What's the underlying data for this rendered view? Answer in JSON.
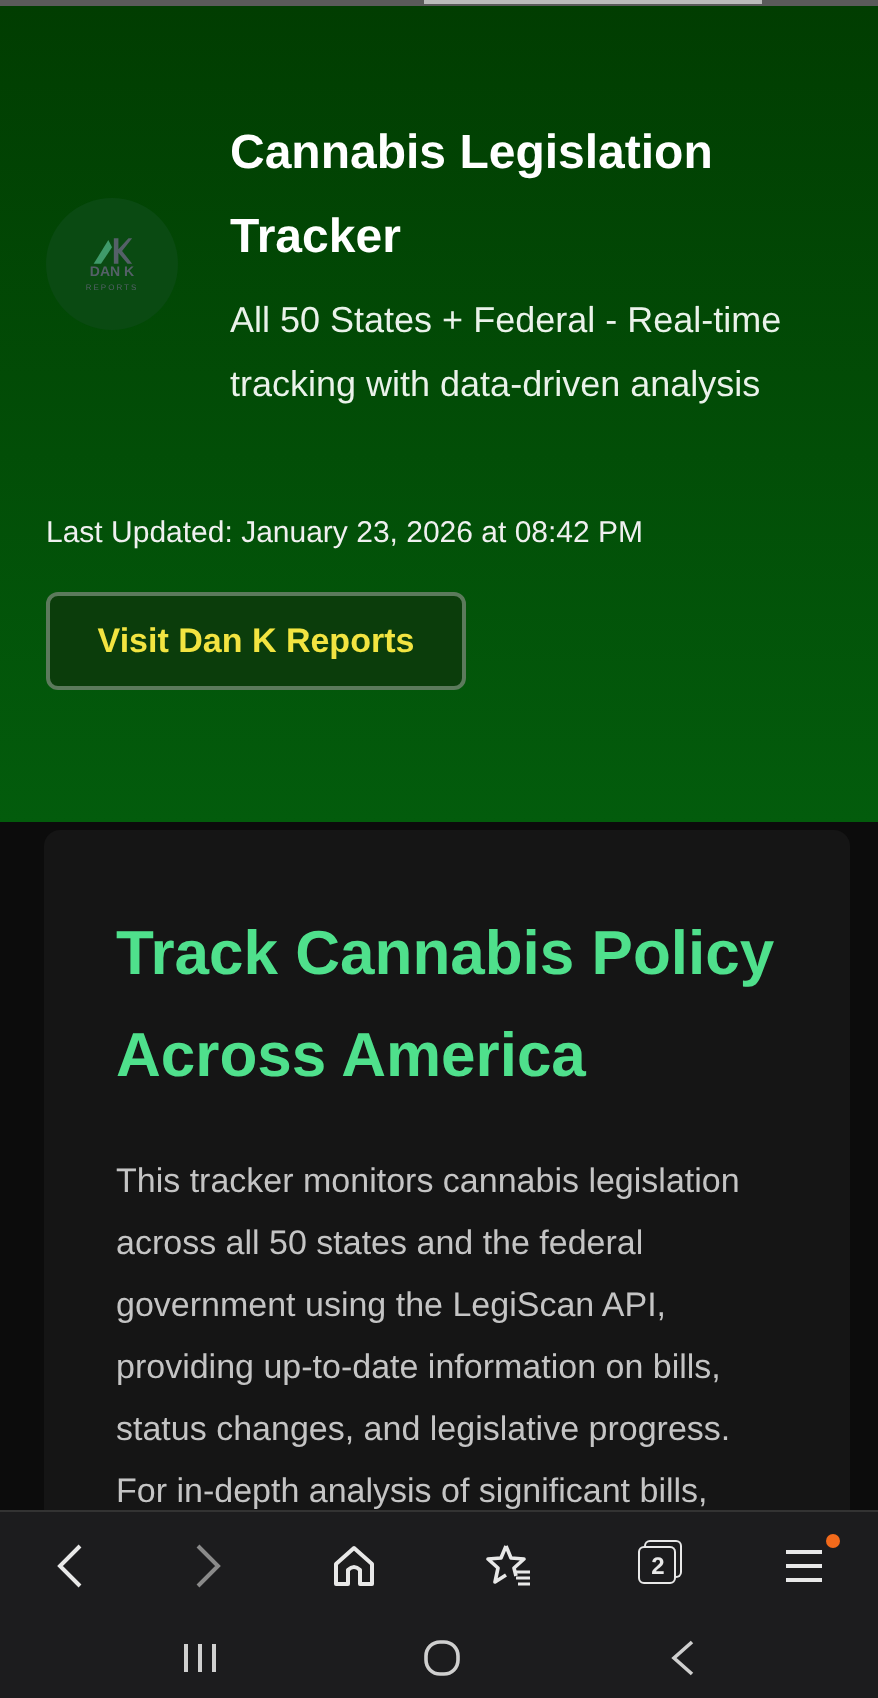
{
  "header": {
    "logo": {
      "name": "DAN K",
      "tagline": "REPORTS"
    },
    "title": "Cannabis Legislation Tracker",
    "subtitle": "All 50 States + Federal - Real-time tracking with data-driven analysis",
    "last_updated": "Last Updated: January 23, 2026 at 08:42 PM",
    "button": "Visit Dan K Reports"
  },
  "intro": {
    "heading": "Track Cannabis Policy Across America",
    "paragraph": "This tracker monitors cannabis legislation across all 50 states and the federal government using the LegiScan API, providing up-to-date information on bills, status changes, and legislative progress. For in-depth analysis of significant bills,"
  },
  "browser_toolbar": {
    "tab_count": "2",
    "menu_notification": true
  }
}
